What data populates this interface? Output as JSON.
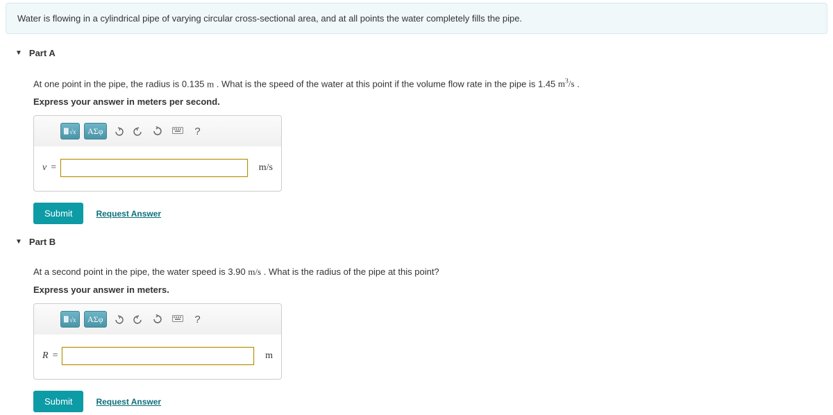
{
  "intro": "Water is flowing in a cylindrical pipe of varying circular cross-sectional area, and at all points the water completely fills the pipe.",
  "partA": {
    "title": "Part A",
    "q_pre": "At one point in the pipe, the radius is 0.135 ",
    "q_unit1": "m",
    "q_mid": " . What is the speed of the water at this point if the volume flow rate in the pipe is 1.45 ",
    "q_unit2_base": "m",
    "q_unit2_exp": "3",
    "q_unit2_per": "/s",
    "q_post": " .",
    "instruction": "Express your answer in meters per second.",
    "var": "v",
    "eq": "=",
    "units": "m/s",
    "submit": "Submit",
    "request": "Request Answer"
  },
  "partB": {
    "title": "Part B",
    "q_pre": "At a second point in the pipe, the water speed is 3.90 ",
    "q_unit1": "m/s",
    "q_post": " . What is the radius of the pipe at this point?",
    "instruction": "Express your answer in meters.",
    "var": "R",
    "eq": "=",
    "units": "m",
    "submit": "Submit",
    "request": "Request Answer"
  },
  "toolbar": {
    "sqrt": "x√x",
    "greek": "ΑΣφ",
    "help": "?"
  }
}
